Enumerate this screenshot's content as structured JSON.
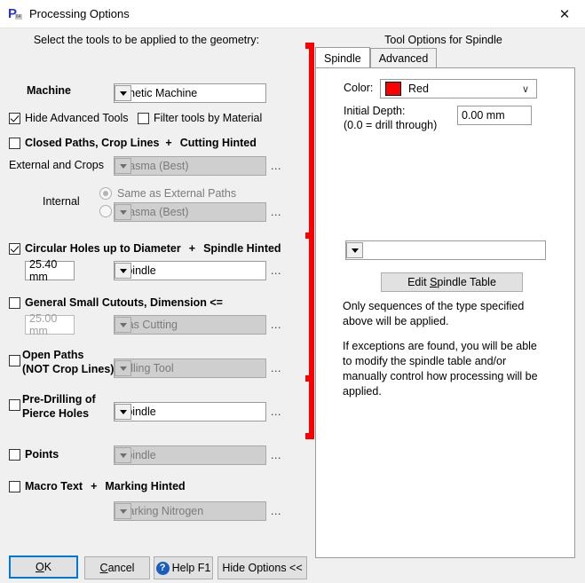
{
  "window": {
    "title": "Processing Options",
    "icon": "app-p64-icon",
    "icon_letter": "P",
    "icon_sub": "64",
    "close_glyph": "✕"
  },
  "left": {
    "header": "Select the tools to be applied to the geometry:",
    "machine_label": "Machine",
    "machine_value": "Kinetic Machine",
    "hide_advanced_tools": {
      "label": "Hide Advanced Tools",
      "checked": true
    },
    "filter_tools_by_material": {
      "label": "Filter tools by Material",
      "checked": false
    },
    "closed_paths": {
      "label": "Closed Paths,  Crop Lines",
      "plus": "+",
      "hint": "Cutting Hinted",
      "checked": false
    },
    "external_and_crops_label": "External and Crops",
    "external_and_crops_value": "Plasma (Best)",
    "internal_label": "Internal",
    "internal_same_as_external": "Same as External Paths",
    "internal_value": "Plasma (Best)",
    "circular_holes": {
      "label": "Circular Holes up to Diameter",
      "plus": "+",
      "hint": "Spindle Hinted",
      "checked": true,
      "diameter": "25.40 mm",
      "tool": "Spindle"
    },
    "general_small_cutouts": {
      "label": "General Small Cutouts, Dimension <=",
      "checked": false,
      "dimension": "25.00 mm",
      "tool": "Gas Cutting"
    },
    "open_paths": {
      "label_line1": "Open Paths",
      "label_line2": "(NOT Crop Lines)",
      "checked": false,
      "tool": "Milling Tool"
    },
    "pre_drilling": {
      "label_line1": "Pre-Drilling of",
      "label_line2": "Pierce Holes",
      "checked": false,
      "tool": "Spindle"
    },
    "points": {
      "label": "Points",
      "checked": false,
      "tool": "Spindle"
    },
    "macro_text": {
      "label": "Macro Text",
      "plus": "+",
      "hint": "Marking Hinted",
      "checked": false,
      "tool": "Marking Nitrogen"
    },
    "ellipsis": "..."
  },
  "right": {
    "title": "Tool Options for Spindle",
    "tabs": [
      {
        "label": "Spindle",
        "active": true
      },
      {
        "label": "Advanced",
        "active": false
      }
    ],
    "color_label": "Color:",
    "color_value": "Red",
    "color_hex": "#ff0000",
    "initial_depth_label_line1": "Initial Depth:",
    "initial_depth_label_line2": "(0.0 = drill through)",
    "initial_depth_value": "0.00 mm",
    "sequence_value": "*",
    "edit_spindle_table": {
      "pre": "Edit ",
      "mnemonic": "S",
      "post": "pindle Table"
    },
    "note1_line1": "Only sequences of the type specified",
    "note1_line2": "above will be applied.",
    "note2_line1": " If exceptions are found, you will be able",
    "note2_line2": "to modify the spindle table and/or",
    "note2_line3": "manually control how processing will be",
    "note2_line4": "applied.",
    "annotation_color": "#fb0000"
  },
  "footer": {
    "ok": {
      "pre": "",
      "mnemonic": "O",
      "post": "K"
    },
    "cancel": {
      "pre": "",
      "mnemonic": "C",
      "post": "ancel"
    },
    "help": {
      "label": "Help F1",
      "icon": "?"
    },
    "hide_options": "Hide Options <<"
  }
}
